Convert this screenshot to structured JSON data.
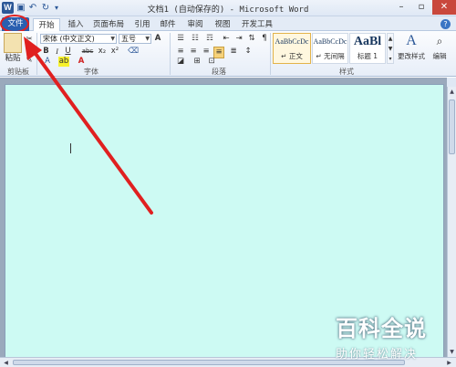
{
  "window": {
    "title": "文档1 (自动保存的) - Microsoft Word",
    "app_icon": "W",
    "qat": [
      "save-icon",
      "undo-icon",
      "redo-icon",
      "customize-icon"
    ],
    "controls": [
      "minimize",
      "maximize",
      "close"
    ]
  },
  "tabs": {
    "file": "文件",
    "items": [
      "开始",
      "插入",
      "页面布局",
      "引用",
      "邮件",
      "审阅",
      "视图",
      "开发工具"
    ],
    "active": "开始"
  },
  "ribbon": {
    "clipboard": {
      "paste_label": "粘贴",
      "group_label": "剪贴板"
    },
    "font": {
      "font_name": "宋体 (中文正文)",
      "font_size": "五号",
      "group_label": "字体",
      "buttons": [
        "B",
        "I",
        "U",
        "abc",
        "x₂",
        "x²",
        "A"
      ]
    },
    "paragraph": {
      "group_label": "段落"
    },
    "styles": {
      "group_label": "样式",
      "items": [
        {
          "sample": "AaBbCcDc",
          "name": "↵ 正文",
          "selected": true
        },
        {
          "sample": "AaBbCcDc",
          "name": "↵ 无间隔",
          "selected": false
        },
        {
          "sample": "AaBl",
          "name": "标题 1",
          "selected": false
        }
      ],
      "change_styles": "更改样式",
      "editing": "编辑"
    }
  },
  "document": {
    "page_color": "#cdfaf3"
  },
  "annotation": {
    "arrow_color": "#e02020"
  },
  "watermark": {
    "main": "百科全说",
    "sub": "助你轻松解决"
  }
}
